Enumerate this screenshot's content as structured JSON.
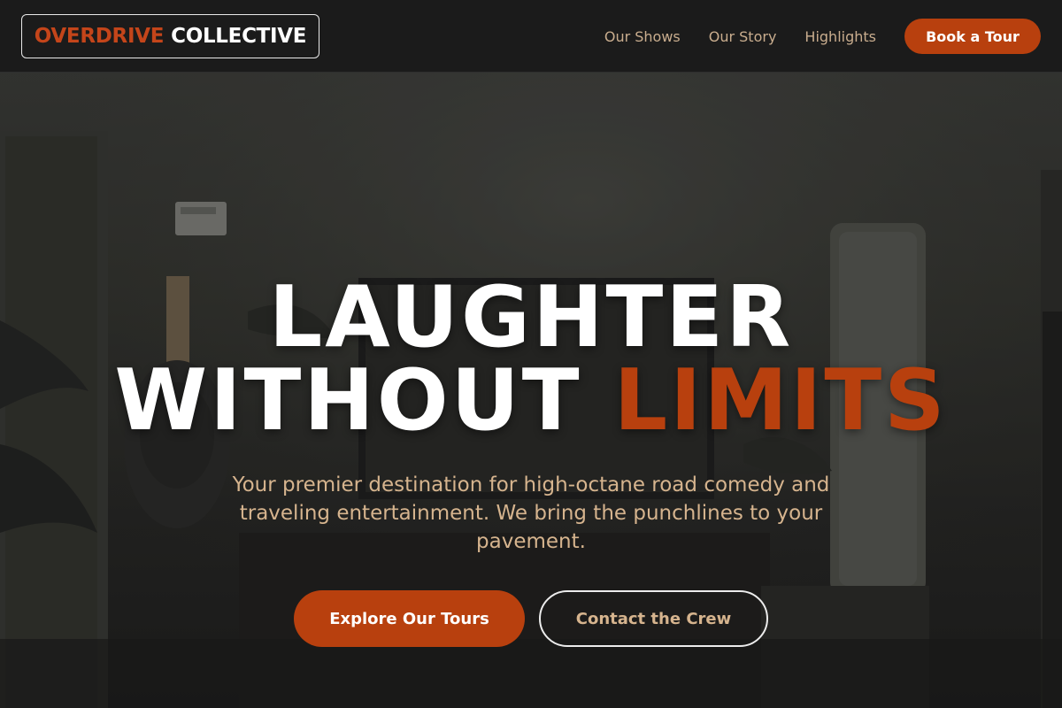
{
  "brand": {
    "part1": "OVERDRIVE",
    "part2": "COLLECTIVE"
  },
  "nav": {
    "links": [
      "Our Shows",
      "Our Story",
      "Highlights"
    ],
    "cta": "Book a Tour"
  },
  "hero": {
    "headline_line1": "LAUGHTER",
    "headline_line2_start": "WITHOUT",
    "headline_line2_accent": "LIMITS",
    "tagline": "Your premier destination for high-octane road comedy and traveling entertainment. We bring the punchlines to your pavement.",
    "primary_button": "Explore Our Tours",
    "secondary_button": "Contact the Crew",
    "background_image": "room-with-guitar-plants-tv"
  },
  "colors": {
    "accent": "#b8400e",
    "nav_bg": "#1b1b1b",
    "tagline": "#d6b48e",
    "nav_link": "#c9ad8e"
  }
}
